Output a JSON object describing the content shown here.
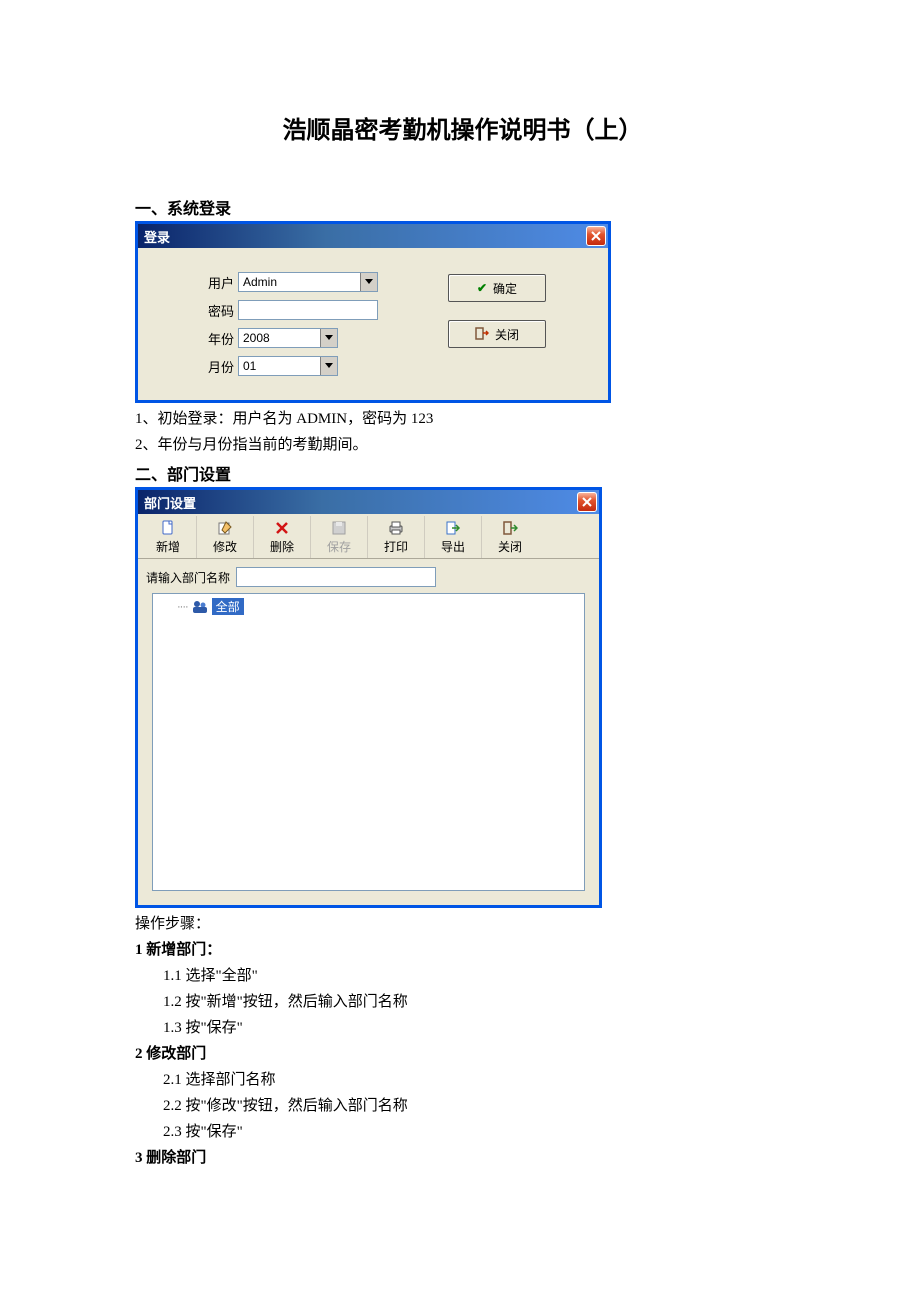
{
  "doc": {
    "title": "浩顺晶密考勤机操作说明书（上）",
    "section1": "一、系统登录",
    "note1": "1、初始登录：用户名为 ADMIN，密码为 123",
    "note2": "2、年份与月份指当前的考勤期间。",
    "section2": "二、部门设置",
    "steps_label": "操作步骤：",
    "s1": "1 新增部门：",
    "s1_1": "1.1 选择\"全部\"",
    "s1_2": "1.2 按\"新增\"按钮，然后输入部门名称",
    "s1_3": "1.3 按\"保存\"",
    "s2": "2 修改部门",
    "s2_1": "2.1 选择部门名称",
    "s2_2": "2.2 按\"修改\"按钮，然后输入部门名称",
    "s2_3": "2.3 按\"保存\"",
    "s3": "3 删除部门"
  },
  "login": {
    "title": "登录",
    "user_label": "用户",
    "user_value": "Admin",
    "pass_label": "密码",
    "pass_value": "",
    "year_label": "年份",
    "year_value": "2008",
    "month_label": "月份",
    "month_value": "01",
    "ok": "确定",
    "close": "关闭"
  },
  "dept": {
    "title": "部门设置",
    "tb": {
      "add": "新增",
      "edit": "修改",
      "del": "删除",
      "save": "保存",
      "print": "打印",
      "export": "导出",
      "close": "关闭"
    },
    "filter_label": "请输入部门名称",
    "filter_value": "",
    "root": "全部"
  }
}
